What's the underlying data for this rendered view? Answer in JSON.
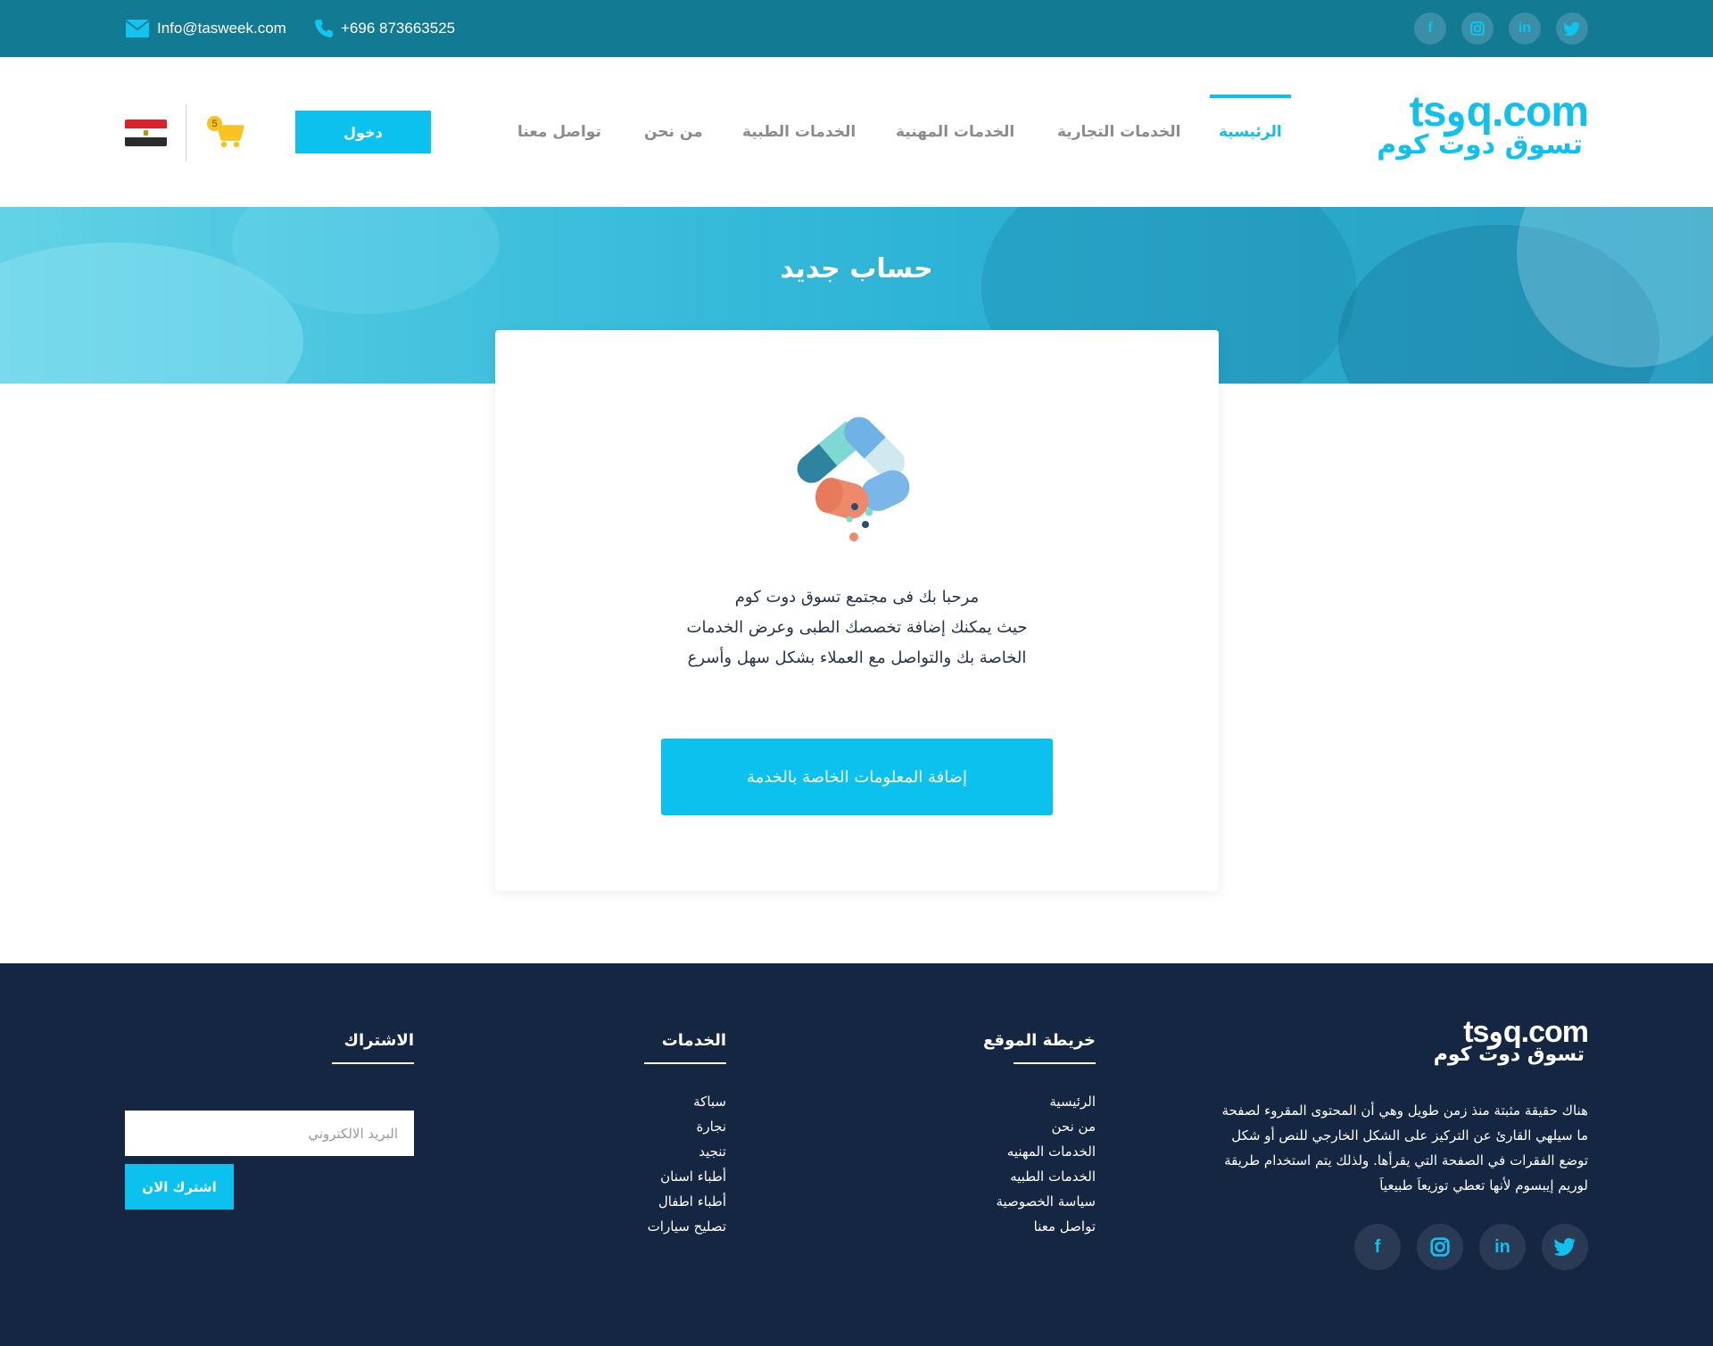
{
  "topbar": {
    "email": "Info@tasweek.com",
    "phone": "+696 873663525",
    "social": [
      "facebook-icon",
      "instagram-icon",
      "linkedin-icon",
      "twitter-icon"
    ]
  },
  "header": {
    "logo_latin": "tsوq.com",
    "logo_arabic": "تسوق دوت كوم",
    "nav": [
      {
        "label": "الرئيسية",
        "active": true
      },
      {
        "label": "الخدمات التجارية",
        "active": false
      },
      {
        "label": "الخدمات المهنية",
        "active": false
      },
      {
        "label": "الخدمات الطبية",
        "active": false
      },
      {
        "label": "من نحن",
        "active": false
      },
      {
        "label": "تواصل معنا",
        "active": false
      }
    ],
    "login_label": "دخول",
    "cart_count": "5",
    "flag": "egypt"
  },
  "banner": {
    "title": "حساب جديد"
  },
  "card": {
    "welcome_lines": [
      "مرحبا بك فى مجتمع تسوق دوت كوم",
      "حيث يمكنك إضافة تخصصك الطبى وعرض الخدمات",
      "الخاصة بك والتواصل مع العملاء بشكل سهل وأسرع"
    ],
    "add_button_label": "إضافة المعلومات الخاصة بالخدمة"
  },
  "footer": {
    "logo_latin": "tsوq.com",
    "logo_arabic": "تسوق دوت كوم",
    "about": "هناك حقيقة مثبتة منذ زمن طويل وهي أن المحتوى المقروء لصفحة ما سيلهي القارئ عن التركيز على الشكل الخارجي للنص أو شكل توضع الفقرات في الصفحة التي يقرأها. ولذلك يتم استخدام طريقة لوريم إيبسوم لأنها تعطي توزيعاَ طبيعياَ",
    "sitemap": {
      "title": "خريطة الموقع",
      "items": [
        "الرئيسية",
        "من نحن",
        "الخدمات المهنيه",
        "الخدمات الطبيه",
        "سياسة الخصوصية",
        "تواصل معنا"
      ]
    },
    "services": {
      "title": "الخدمات",
      "items": [
        "سباكة",
        "نجارة",
        "تنجيد",
        "أطباء اسنان",
        "أطباء اطفال",
        "تصليح سيارات"
      ]
    },
    "subscribe": {
      "title": "الاشتراك",
      "placeholder": "البريد الالكتروني",
      "button_label": "اشترك الان"
    },
    "social": [
      "facebook-icon",
      "instagram-icon",
      "linkedin-icon",
      "twitter-icon"
    ]
  },
  "colors": {
    "accent": "#0dc1ee",
    "topbar": "#137a93",
    "footer": "#152642",
    "cart": "#f8c21f"
  }
}
